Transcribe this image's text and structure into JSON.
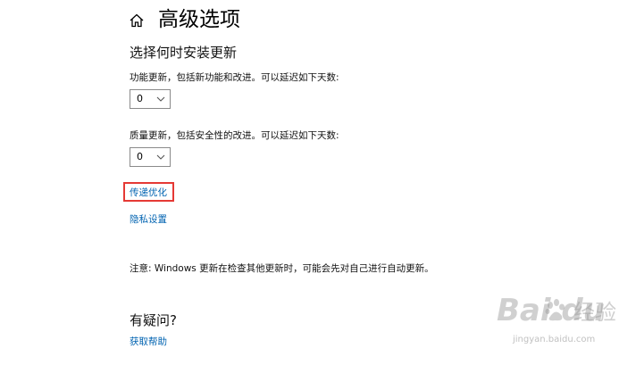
{
  "header": {
    "title": "高级选项",
    "home_icon": "home-icon"
  },
  "update_schedule": {
    "section_title": "选择何时安装更新",
    "feature_update_label": "功能更新，包括新功能和改进。可以延迟如下天数:",
    "feature_update_value": "0",
    "quality_update_label": "质量更新，包括安全性的改进。可以延迟如下天数:",
    "quality_update_value": "0"
  },
  "links": {
    "delivery_optimization": "传递优化",
    "privacy_settings": "隐私设置"
  },
  "note": "注意: Windows 更新在检查其他更新时，可能会先对自己进行自动更新。",
  "faq": {
    "title": "有疑问?",
    "get_help": "获取帮助"
  },
  "watermark": {
    "brand": "Bai  du",
    "cn": "经验",
    "url": "jingyan.baidu.com"
  },
  "colors": {
    "link": "#0063b1",
    "highlight": "#e53935",
    "text": "#000000",
    "background": "#ffffff"
  }
}
